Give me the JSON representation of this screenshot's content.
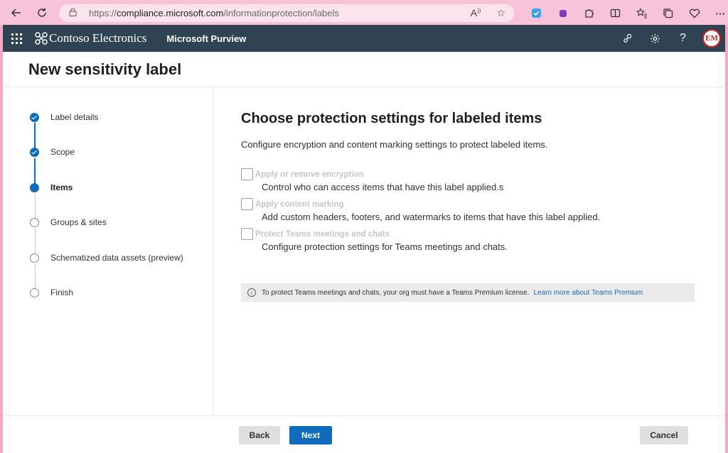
{
  "browser": {
    "url_prefix": "https://",
    "url_host": "compliance.microsoft.com",
    "url_path": "/informationprotection/labels"
  },
  "suitebar": {
    "org_name": "Contoso Electronics",
    "app_name": "Microsoft Purview",
    "avatar_initials": "EM"
  },
  "page": {
    "title": "New sensitivity label"
  },
  "steps": [
    {
      "label": "Label details",
      "state": "done"
    },
    {
      "label": "Scope",
      "state": "done"
    },
    {
      "label": "Items",
      "state": "current"
    },
    {
      "label": "Groups & sites",
      "state": "todo"
    },
    {
      "label": "Schematized data assets (preview)",
      "state": "todo"
    },
    {
      "label": "Finish",
      "state": "todo"
    }
  ],
  "main": {
    "title": "Choose protection settings for labeled items",
    "description": "Configure encryption and content marking settings to protect labeled items.",
    "options": [
      {
        "label": "Apply or remove encryption",
        "description": "Control who can access items that have this label applied.s",
        "checked": false
      },
      {
        "label": "Apply content marking",
        "description": "Add custom headers, footers, and watermarks to items that have this label applied.",
        "checked": false
      },
      {
        "label": "Protect Teams meetings and chats",
        "description": "Configure protection settings for Teams meetings and chats.",
        "checked": false
      }
    ],
    "info": {
      "text": "To protect Teams meetings and chats, your org must have a Teams Premium license.",
      "link": "Learn more about Teams Premium"
    }
  },
  "footer": {
    "back_label": "Back",
    "next_label": "Next",
    "cancel_label": "Cancel"
  },
  "colors": {
    "accent": "#0f6cbd",
    "suitebar": "#2f4353",
    "browser_frame": "#f4a9c8"
  }
}
